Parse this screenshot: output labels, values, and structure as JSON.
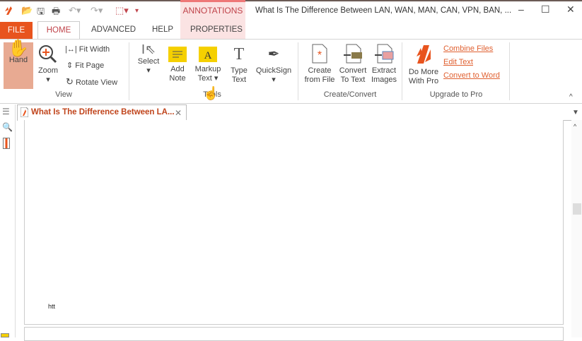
{
  "titlebar": {
    "title": "What Is The Difference Between LAN, WAN, MAN, CAN, VPN, BAN, ...",
    "context_tab": "ANNOTATIONS",
    "minimize": "–",
    "maximize": "☐",
    "close": "✕"
  },
  "tabs": {
    "file": "FILE",
    "home": "HOME",
    "advanced": "ADVANCED",
    "help": "HELP",
    "properties": "PROPERTIES"
  },
  "ribbon": {
    "view": {
      "hand": "Hand",
      "zoom": "Zoom",
      "fit_width": "Fit Width",
      "fit_page": "Fit Page",
      "rotate_view": "Rotate View",
      "group": "View"
    },
    "tools": {
      "select": "Select",
      "add_note": [
        "Add",
        "Note"
      ],
      "markup_text": [
        "Markup",
        "Text"
      ],
      "type_text": [
        "Type",
        "Text"
      ],
      "quicksign": "QuickSign",
      "group": "Tools"
    },
    "create": {
      "create_from_file": [
        "Create",
        "from File"
      ],
      "convert_to_text": [
        "Convert",
        "To Text"
      ],
      "extract_images": [
        "Extract",
        "Images"
      ],
      "group": "Create/Convert"
    },
    "pro": {
      "do_more": [
        "Do More",
        "With Pro"
      ],
      "combine_files": "Combine Files",
      "edit_text": "Edit Text",
      "convert_to_word": "Convert to Word",
      "group": "Upgrade to Pro"
    }
  },
  "document": {
    "tab_title": "What Is The Difference Between LA...",
    "close": "✕",
    "page_fragment": "htt"
  },
  "colors": {
    "accent": "#e8541e",
    "hand_active": "#e8aa92",
    "context": "#fbe3e3"
  }
}
